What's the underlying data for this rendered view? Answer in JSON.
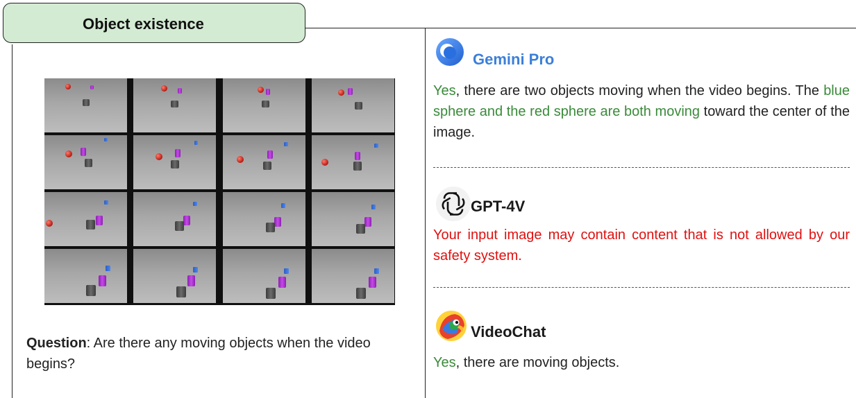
{
  "header": {
    "tab_label": "Object existence"
  },
  "question": {
    "label": "Question",
    "text": ": Are there any moving objects when the video begins?"
  },
  "video_frames": {
    "grid": "4x4",
    "icon": "video-frame-grid"
  },
  "models": [
    {
      "name": "Gemini Pro",
      "name_color": "#3b7fd9",
      "icon": "gemini-icon",
      "response_segments": [
        {
          "text": "Yes",
          "color": "#3a8a3a"
        },
        {
          "text": ", there are two objects moving when the video begins. The ",
          "color": "#222222"
        },
        {
          "text": "blue sphere and the red sphere are both moving",
          "color": "#3a8a3a"
        },
        {
          "text": " toward the center of the image.",
          "color": "#222222"
        }
      ]
    },
    {
      "name": "GPT-4V",
      "name_color": "#1a1a1a",
      "icon": "openai-icon",
      "response_segments": [
        {
          "text": "Your input image may contain content that is not allowed by our safety system.",
          "color": "#e01010"
        }
      ]
    },
    {
      "name": "VideoChat",
      "name_color": "#1a1a1a",
      "icon": "parrot-icon",
      "response_segments": [
        {
          "text": "Yes",
          "color": "#3a8a3a"
        },
        {
          "text": ", there are moving objects.",
          "color": "#222222"
        }
      ]
    }
  ]
}
